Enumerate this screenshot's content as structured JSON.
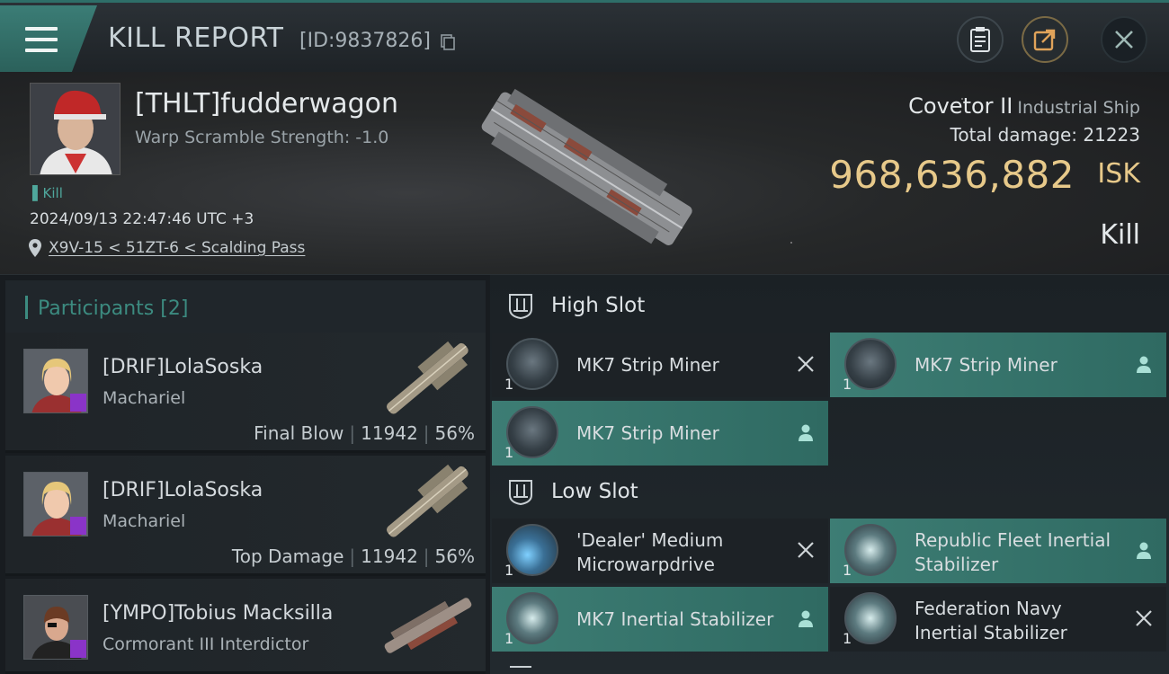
{
  "header": {
    "title": "KILL REPORT",
    "report_id": "[ID:9837826]"
  },
  "victim": {
    "name": "[THLT]fudderwagon",
    "warp_scramble": "Warp Scramble Strength: -1.0",
    "tag": "Kill",
    "timestamp": "2024/09/13 22:47:46 UTC +3",
    "location": "X9V-15 < 51ZT-6 < Scalding Pass",
    "ship_name": "Covetor II",
    "ship_class": "Industrial Ship",
    "total_damage_label": "Total damage:",
    "total_damage": "21223",
    "isk_value": "968,636,882",
    "isk_unit": "ISK",
    "result": "Kill"
  },
  "participants": {
    "label": "Participants",
    "count": "[2]",
    "rows": [
      {
        "name": "[DRIF]LolaSoska",
        "ship": "Machariel",
        "role": "Final Blow",
        "damage": "11942",
        "percent": "56%"
      },
      {
        "name": "[DRIF]LolaSoska",
        "ship": "Machariel",
        "role": "Top Damage",
        "damage": "11942",
        "percent": "56%"
      },
      {
        "name": "[YMPO]Tobius Macksilla",
        "ship": "Cormorant III Interdictor",
        "role": "",
        "damage": "",
        "percent": ""
      }
    ]
  },
  "fittings": {
    "high_slot": {
      "title": "High Slot",
      "modules": [
        {
          "name": "MK7 Strip Miner",
          "qty": "1",
          "status": "destroyed"
        },
        {
          "name": "MK7 Strip Miner",
          "qty": "1",
          "status": "dropped"
        },
        {
          "name": "MK7 Strip Miner",
          "qty": "1",
          "status": "dropped"
        }
      ]
    },
    "low_slot": {
      "title": "Low Slot",
      "modules": [
        {
          "name": "'Dealer' Medium Microwarpdrive",
          "qty": "1",
          "status": "destroyed"
        },
        {
          "name": "Republic Fleet Inertial Stabilizer",
          "qty": "1",
          "status": "dropped"
        },
        {
          "name": "MK7 Inertial Stabilizer",
          "qty": "1",
          "status": "dropped"
        },
        {
          "name": "Federation Navy Inertial Stabilizer",
          "qty": "1",
          "status": "destroyed"
        }
      ]
    }
  },
  "colors": {
    "accent": "#3c8b80",
    "isk_gold": "#e7c98a",
    "dropped_bg": "#3d7d74",
    "corp_badge": "#8a34c8"
  },
  "icons": {
    "menu": "hamburger-icon",
    "copy": "copy-icon",
    "clipboard": "clipboard-icon",
    "share": "share-icon",
    "close": "close-icon",
    "location": "location-pin-icon",
    "slot": "slot-icon",
    "destroyed": "x-mark-icon",
    "dropped": "person-icon"
  }
}
